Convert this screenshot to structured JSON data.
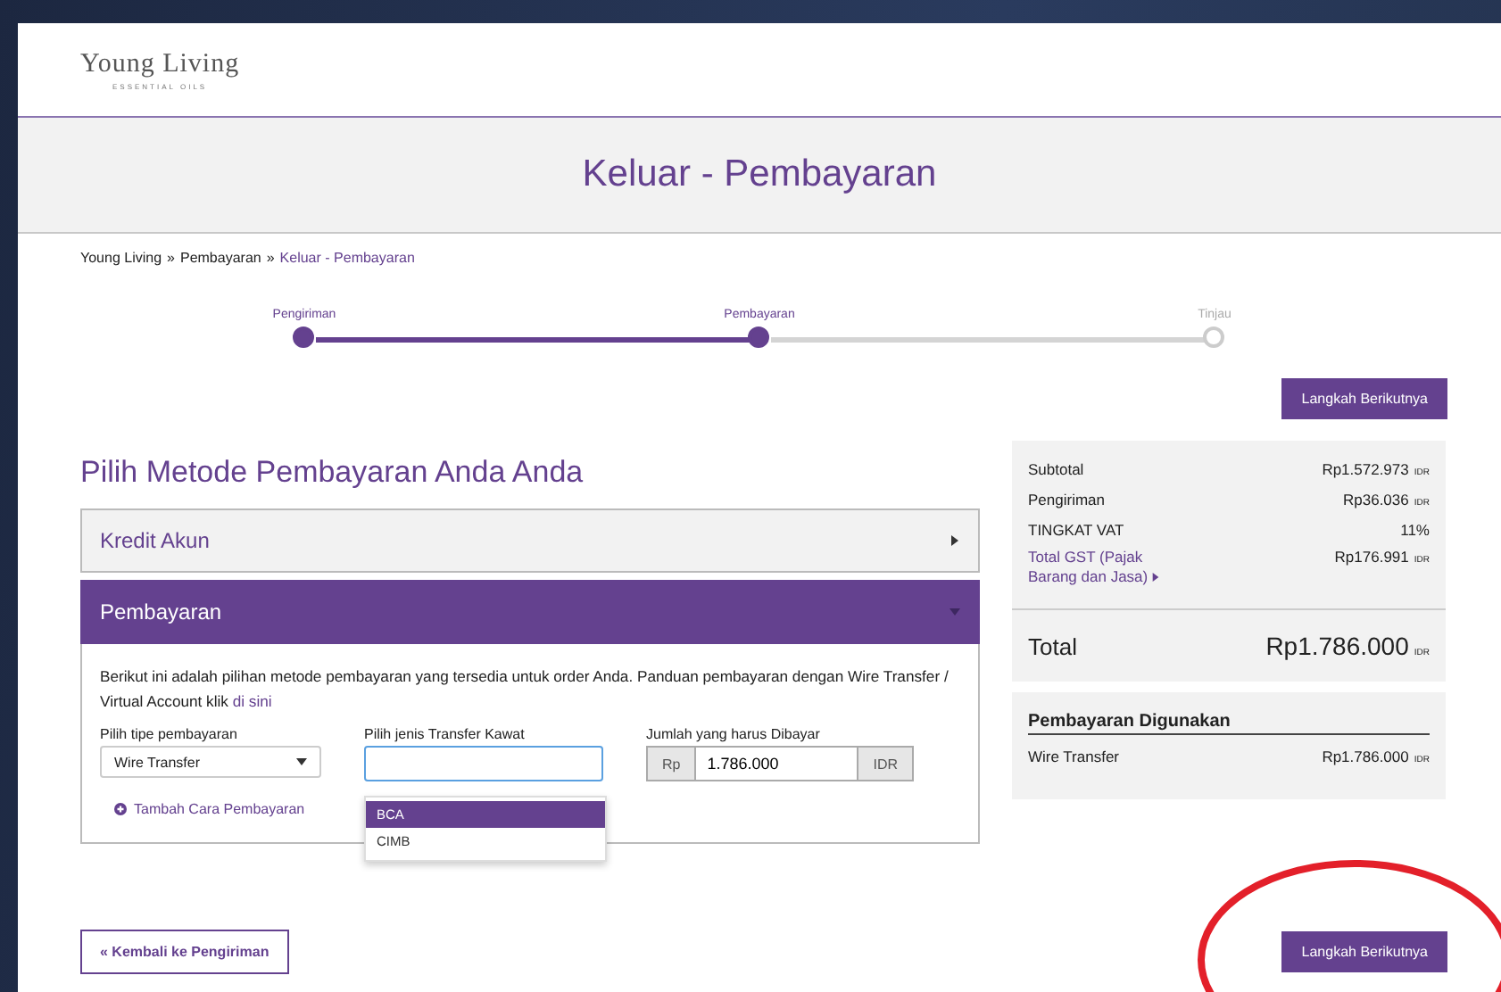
{
  "logo": {
    "name": "Young Living",
    "tagline": "ESSENTIAL OILS"
  },
  "page_title": "Keluar - Pembayaran",
  "breadcrumb": [
    {
      "label": "Young Living",
      "current": false
    },
    {
      "label": "Pembayaran",
      "current": false
    },
    {
      "label": "Keluar - Pembayaran",
      "current": true
    }
  ],
  "breadcrumb_separator": "»",
  "steps": [
    {
      "label": "Pengiriman",
      "kind": "done"
    },
    {
      "label": "Pembayaran",
      "kind": "current"
    },
    {
      "label": "Tinjau",
      "kind": "upcoming"
    }
  ],
  "next_button_top": "Langkah Berikutnya",
  "section_title": "Pilih Metode Pembayaran Anda Anda",
  "accordion": [
    {
      "title": "Kredit Akun",
      "expanded": false
    },
    {
      "title": "Pembayaran",
      "expanded": true
    }
  ],
  "payment": {
    "intro": "Berikut ini adalah pilihan metode pembayaran yang tersedia untuk order Anda. Panduan pembayaran dengan Wire Transfer / Virtual Account klik",
    "intro_link": "di sini",
    "type_label": "Pilih tipe pembayaran",
    "type_value": "Wire Transfer",
    "transfer_label": "Pilih jenis Transfer Kawat",
    "transfer_options": [
      {
        "label": "BCA",
        "selected": true
      },
      {
        "label": "CIMB",
        "selected": false
      }
    ],
    "amount_label": "Jumlah yang harus Dibayar",
    "amount_prefix": "Rp",
    "amount_value": "1.786.000",
    "amount_suffix": "IDR",
    "add_method": "Tambah Cara Pembayaran"
  },
  "summary": {
    "rows": [
      {
        "label": "Subtotal",
        "value": "Rp1.572.973",
        "currency": "IDR",
        "kind": "plain"
      },
      {
        "label": "Pengiriman",
        "value": "Rp36.036",
        "currency": "IDR",
        "kind": "plain"
      },
      {
        "label": "TINGKAT VAT",
        "value": "11%",
        "kind": "plain"
      },
      {
        "label": "Total GST (Pajak Barang dan Jasa)",
        "value": "Rp176.991",
        "currency": "IDR",
        "kind": "link"
      }
    ],
    "total_label": "Total",
    "total_value": "Rp1.786.000",
    "total_currency": "IDR",
    "used_title": "Pembayaran Digunakan",
    "used_method": "Wire Transfer",
    "used_value": "Rp1.786.000",
    "used_currency": "IDR"
  },
  "back_button": "« Kembali ke Pengiriman",
  "next_button_bottom": "Langkah Berikutnya"
}
